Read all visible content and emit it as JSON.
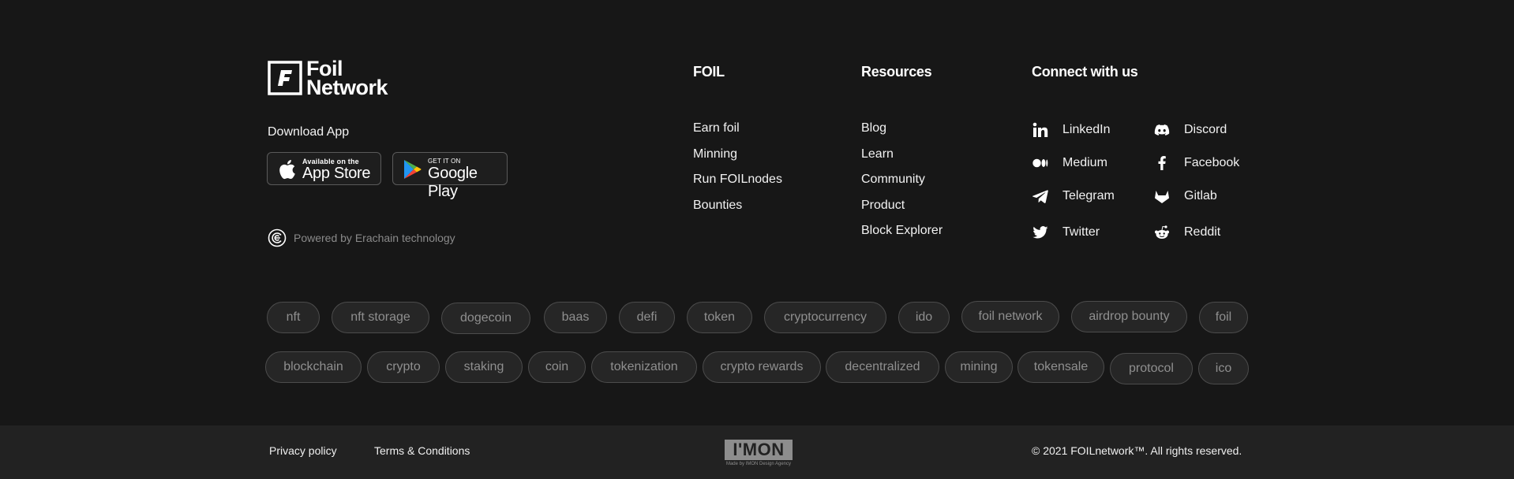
{
  "brand": {
    "line1": "Foil",
    "line2": "Network"
  },
  "download": {
    "label": "Download App",
    "appstore": {
      "small": "Available on the",
      "big": "App Store"
    },
    "googleplay": {
      "small": "GET IT ON",
      "big": "Google Play"
    }
  },
  "powered": "Powered by Erachain technology",
  "columns": {
    "foil": {
      "title": "FOIL",
      "links": [
        "Earn foil",
        "Minning",
        "Run FOILnodes",
        "Bounties"
      ]
    },
    "resources": {
      "title": "Resources",
      "links": [
        "Blog",
        "Learn",
        "Community",
        "Product",
        "Block Explorer"
      ]
    },
    "connect": {
      "title": "Connect with us",
      "items": [
        {
          "label": "LinkedIn",
          "icon": "linkedin-icon"
        },
        {
          "label": "Discord",
          "icon": "discord-icon"
        },
        {
          "label": "Medium",
          "icon": "medium-icon"
        },
        {
          "label": "Facebook",
          "icon": "facebook-icon"
        },
        {
          "label": "Telegram",
          "icon": "telegram-icon"
        },
        {
          "label": "Gitlab",
          "icon": "gitlab-icon"
        },
        {
          "label": "Twitter",
          "icon": "twitter-icon"
        },
        {
          "label": "Reddit",
          "icon": "reddit-icon"
        }
      ]
    }
  },
  "tags": {
    "row1": [
      "nft",
      "nft storage",
      "dogecoin",
      "baas",
      "defi",
      "token",
      "cryptocurrency",
      "ido",
      "foil network",
      "airdrop bounty",
      "foil"
    ],
    "row2": [
      "blockchain",
      "crypto",
      "staking",
      "coin",
      "tokenization",
      "crypto rewards",
      "decentralized",
      "mining",
      "tokensale",
      "protocol",
      "ico"
    ]
  },
  "footer": {
    "privacy": "Privacy policy",
    "terms": "Terms & Conditions",
    "imon": {
      "logo": "I'MON",
      "sub": "Made by IMON Design Agency"
    },
    "copyright": "© 2021 FOILnetwork™. All rights reserved."
  },
  "colors": {
    "background": "#171717",
    "bottom_bar": "#222222",
    "tag_bg": "#262626",
    "tag_border": "#4c4c4c",
    "muted": "#8a8a8a"
  }
}
